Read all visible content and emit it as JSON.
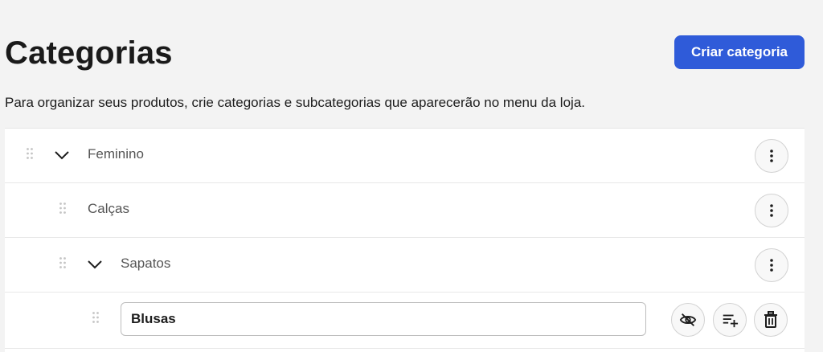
{
  "header": {
    "title": "Categorias",
    "create_button": "Criar categoria",
    "description": "Para organizar seus produtos, crie categorias e subcategorias que aparecerão no menu da loja."
  },
  "categories": [
    {
      "label": "Feminino",
      "expanded": true,
      "actions_icon": "more-vertical-icon"
    },
    {
      "label": "Calças",
      "actions_icon": "more-vertical-icon"
    },
    {
      "label": "Sapatos",
      "expanded": true,
      "actions_icon": "more-vertical-icon"
    }
  ],
  "editing": {
    "value": "Blusas",
    "actions": [
      "eye-off-icon",
      "add-subcategory-icon",
      "trash-icon"
    ]
  },
  "colors": {
    "accent": "#2f5bd9",
    "background": "#f3f3f3",
    "surface": "#ffffff"
  }
}
